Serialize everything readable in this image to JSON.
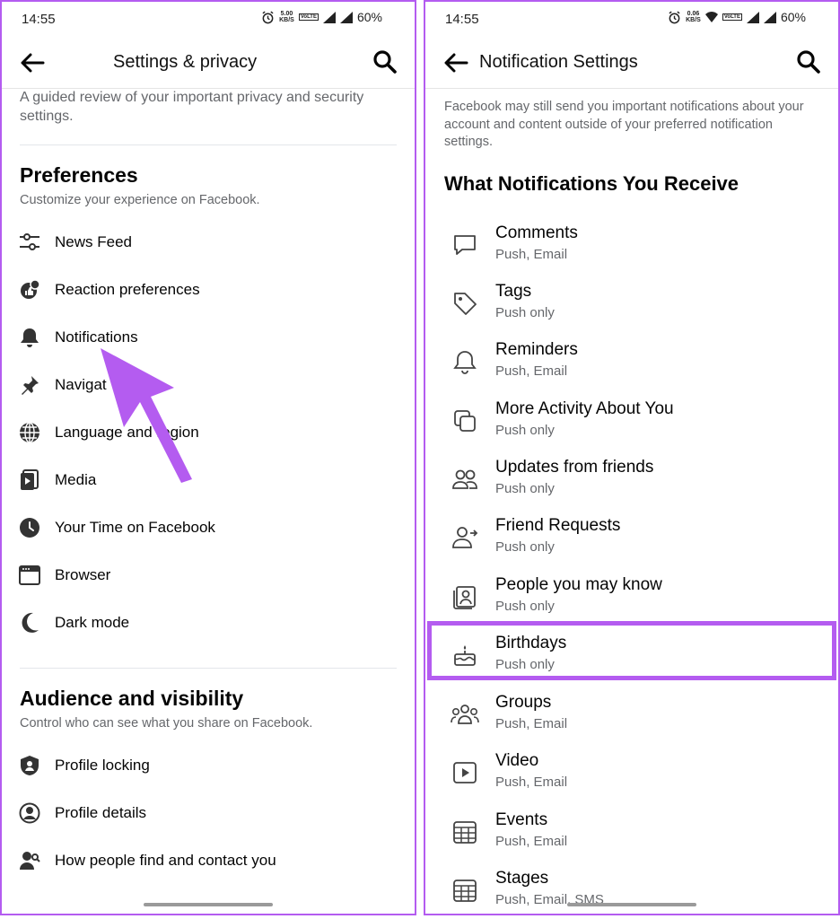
{
  "left": {
    "status": {
      "time": "14:55",
      "speed_top": "5.00",
      "speed_unit": "KB/S",
      "battery": "60%"
    },
    "appbar": {
      "title": "Settings & privacy"
    },
    "intro": "A guided review of your important privacy and security settings.",
    "preferences": {
      "title": "Preferences",
      "subtitle": "Customize your experience on Facebook.",
      "items": [
        {
          "label": "News Feed",
          "icon": "sliders-icon"
        },
        {
          "label": "Reaction preferences",
          "icon": "reaction-icon"
        },
        {
          "label": "Notifications",
          "icon": "bell-icon"
        },
        {
          "label": "Navigat",
          "icon": "pin-icon"
        },
        {
          "label": "Language and region",
          "icon": "globe-icon"
        },
        {
          "label": "Media",
          "icon": "media-icon"
        },
        {
          "label": "Your Time on Facebook",
          "icon": "clock-icon"
        },
        {
          "label": "Browser",
          "icon": "browser-icon"
        },
        {
          "label": "Dark mode",
          "icon": "moon-icon"
        }
      ]
    },
    "audience": {
      "title": "Audience and visibility",
      "subtitle": "Control who can see what you share on Facebook.",
      "items": [
        {
          "label": "Profile locking",
          "icon": "shield-user-icon"
        },
        {
          "label": "Profile details",
          "icon": "user-circle-icon"
        },
        {
          "label": "How people find and contact you",
          "icon": "user-search-icon"
        }
      ]
    }
  },
  "right": {
    "status": {
      "time": "14:55",
      "speed_top": "0.06",
      "speed_unit": "KB/S",
      "battery": "60%"
    },
    "appbar": {
      "title": "Notification Settings"
    },
    "note": "Facebook may still send you important notifications about your account and content outside of your preferred notification settings.",
    "section_title": "What Notifications You Receive",
    "items": [
      {
        "title": "Comments",
        "sub": "Push, Email",
        "icon": "comment-icon"
      },
      {
        "title": "Tags",
        "sub": "Push only",
        "icon": "tag-icon"
      },
      {
        "title": "Reminders",
        "sub": "Push, Email",
        "icon": "bell-icon"
      },
      {
        "title": "More Activity About You",
        "sub": "Push only",
        "icon": "stack-icon"
      },
      {
        "title": "Updates from friends",
        "sub": "Push only",
        "icon": "friends-icon"
      },
      {
        "title": "Friend Requests",
        "sub": "Push only",
        "icon": "add-friend-icon"
      },
      {
        "title": "People you may know",
        "sub": "Push only",
        "icon": "people-card-icon"
      },
      {
        "title": "Birthdays",
        "sub": "Push only",
        "icon": "cake-icon"
      },
      {
        "title": "Groups",
        "sub": "Push, Email",
        "icon": "groups-icon"
      },
      {
        "title": "Video",
        "sub": "Push, Email",
        "icon": "video-icon"
      },
      {
        "title": "Events",
        "sub": "Push, Email",
        "icon": "calendar-icon"
      },
      {
        "title": "Stages",
        "sub": "Push, Email, SMS",
        "icon": "calendar-icon"
      }
    ]
  },
  "colors": {
    "highlight": "#b45cf0",
    "text": "#050505",
    "secondary": "#65676b"
  }
}
